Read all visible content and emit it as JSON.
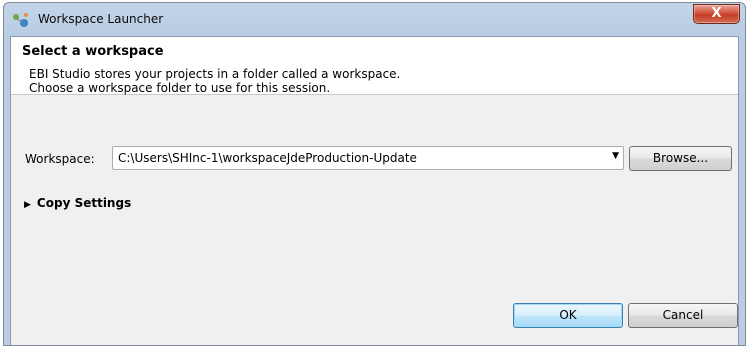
{
  "window": {
    "title": "Workspace Launcher",
    "close_label": "X",
    "app_icon": "eclipse-launcher-icon"
  },
  "header": {
    "title": "Select a workspace",
    "description_line1": "EBI Studio stores your projects in a folder called a workspace.",
    "description_line2": "Choose a workspace folder to use for this session."
  },
  "workspace": {
    "label": "Workspace:",
    "value": "C:\\Users\\SHInc-1\\workspaceJdeProduction-Update",
    "dropdown_icon": "chevron-down-icon",
    "browse_label": "Browse..."
  },
  "copy_settings": {
    "label": "Copy Settings",
    "icon": "triangle-right-icon"
  },
  "footer": {
    "ok_label": "OK",
    "cancel_label": "Cancel"
  }
}
